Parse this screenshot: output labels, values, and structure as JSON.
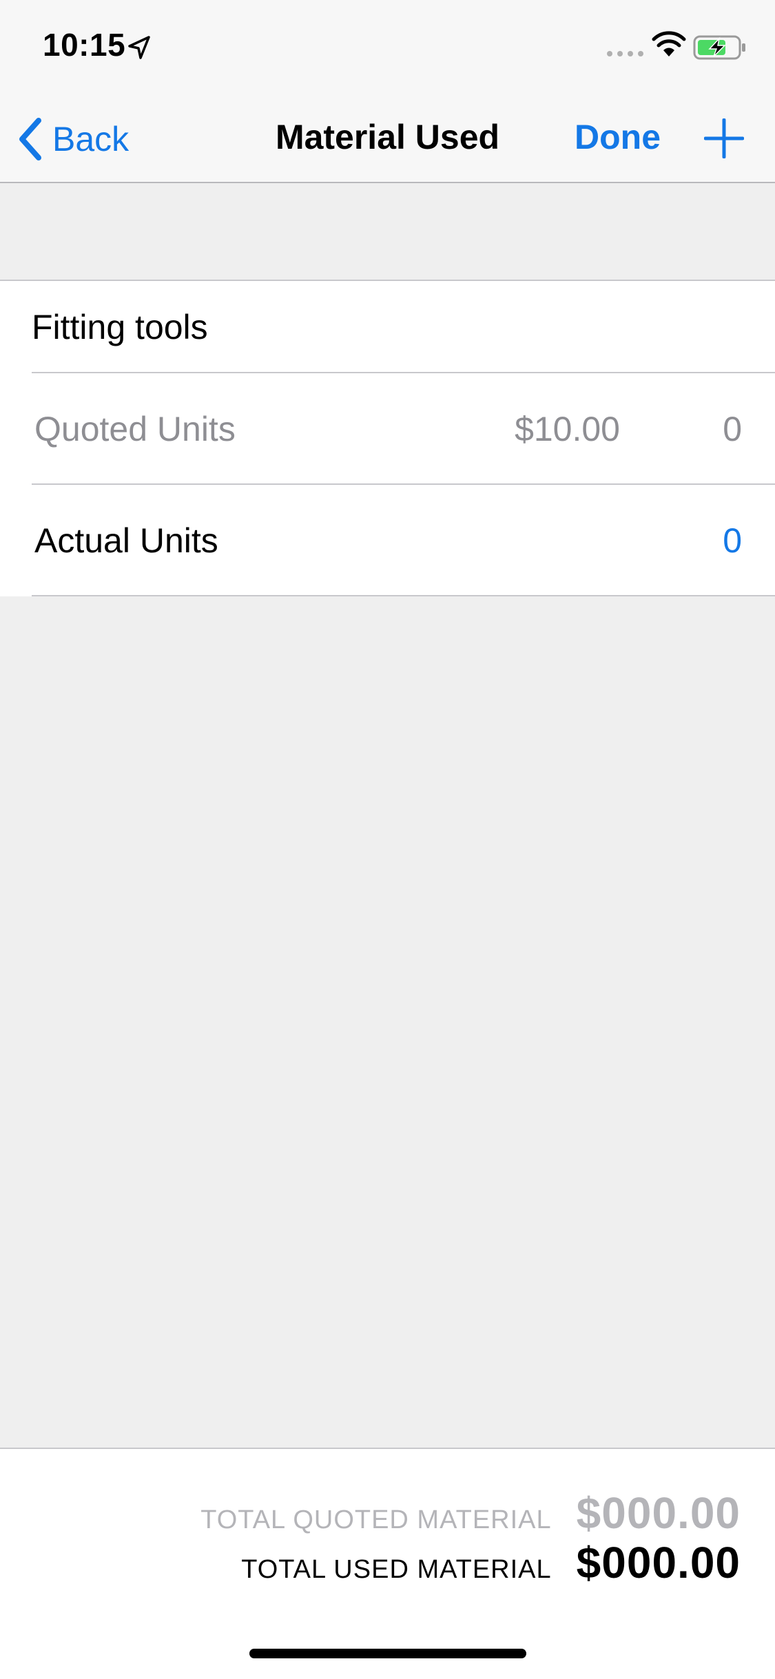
{
  "status_bar": {
    "time": "10:15",
    "icons": [
      "location-arrow-icon",
      "signal-icon",
      "wifi-icon",
      "battery-charging-icon"
    ]
  },
  "nav": {
    "back_label": "Back",
    "title": "Material Used",
    "done_label": "Done",
    "add_icon": "plus-icon",
    "accent_color": "#1478e6"
  },
  "material": {
    "name": "Fitting tools",
    "quoted": {
      "label": "Quoted Units",
      "price": "$10.00",
      "units": "0"
    },
    "actual": {
      "label": "Actual Units",
      "units": "0"
    }
  },
  "totals": {
    "quoted_label": "TOTAL QUOTED MATERIAL",
    "quoted_amount": "$000.00",
    "used_label": "TOTAL USED MATERIAL",
    "used_amount": "$000.00"
  }
}
